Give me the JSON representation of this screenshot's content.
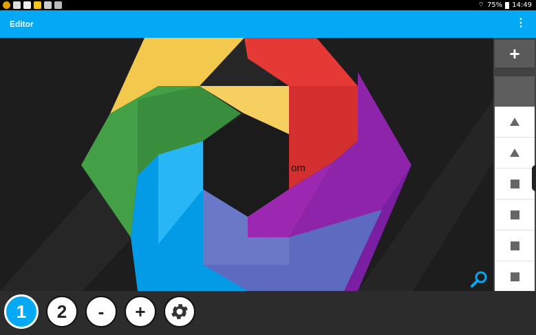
{
  "status_bar": {
    "left_icons": [
      "chrome-icon",
      "image-icon",
      "app-icon",
      "file-icon",
      "photos-icon",
      "app-icon-2"
    ],
    "battery": "75%",
    "time": "14:49"
  },
  "app_bar": {
    "title": "Editor",
    "menu_icon": "more-vert-icon"
  },
  "canvas": {
    "overlay_text": "om",
    "colors": {
      "yellow": "#F2C94C",
      "red": "#E53935",
      "purple": "#8E24AA",
      "indigo": "#5C6BC0",
      "blue": "#039BE5",
      "green": "#43A047",
      "accent": "#03A9F4"
    }
  },
  "side_panel": {
    "add_label": "+",
    "items": [
      {
        "shape": "triangle"
      },
      {
        "shape": "triangle"
      },
      {
        "shape": "square"
      },
      {
        "shape": "square"
      },
      {
        "shape": "square"
      },
      {
        "shape": "square"
      }
    ]
  },
  "bottom_bar": {
    "buttons": [
      {
        "label": "1",
        "active": true
      },
      {
        "label": "2",
        "active": false
      },
      {
        "label": "-",
        "active": false
      },
      {
        "label": "+",
        "active": false
      },
      {
        "label": "",
        "icon": "gear-icon",
        "active": false
      }
    ]
  }
}
